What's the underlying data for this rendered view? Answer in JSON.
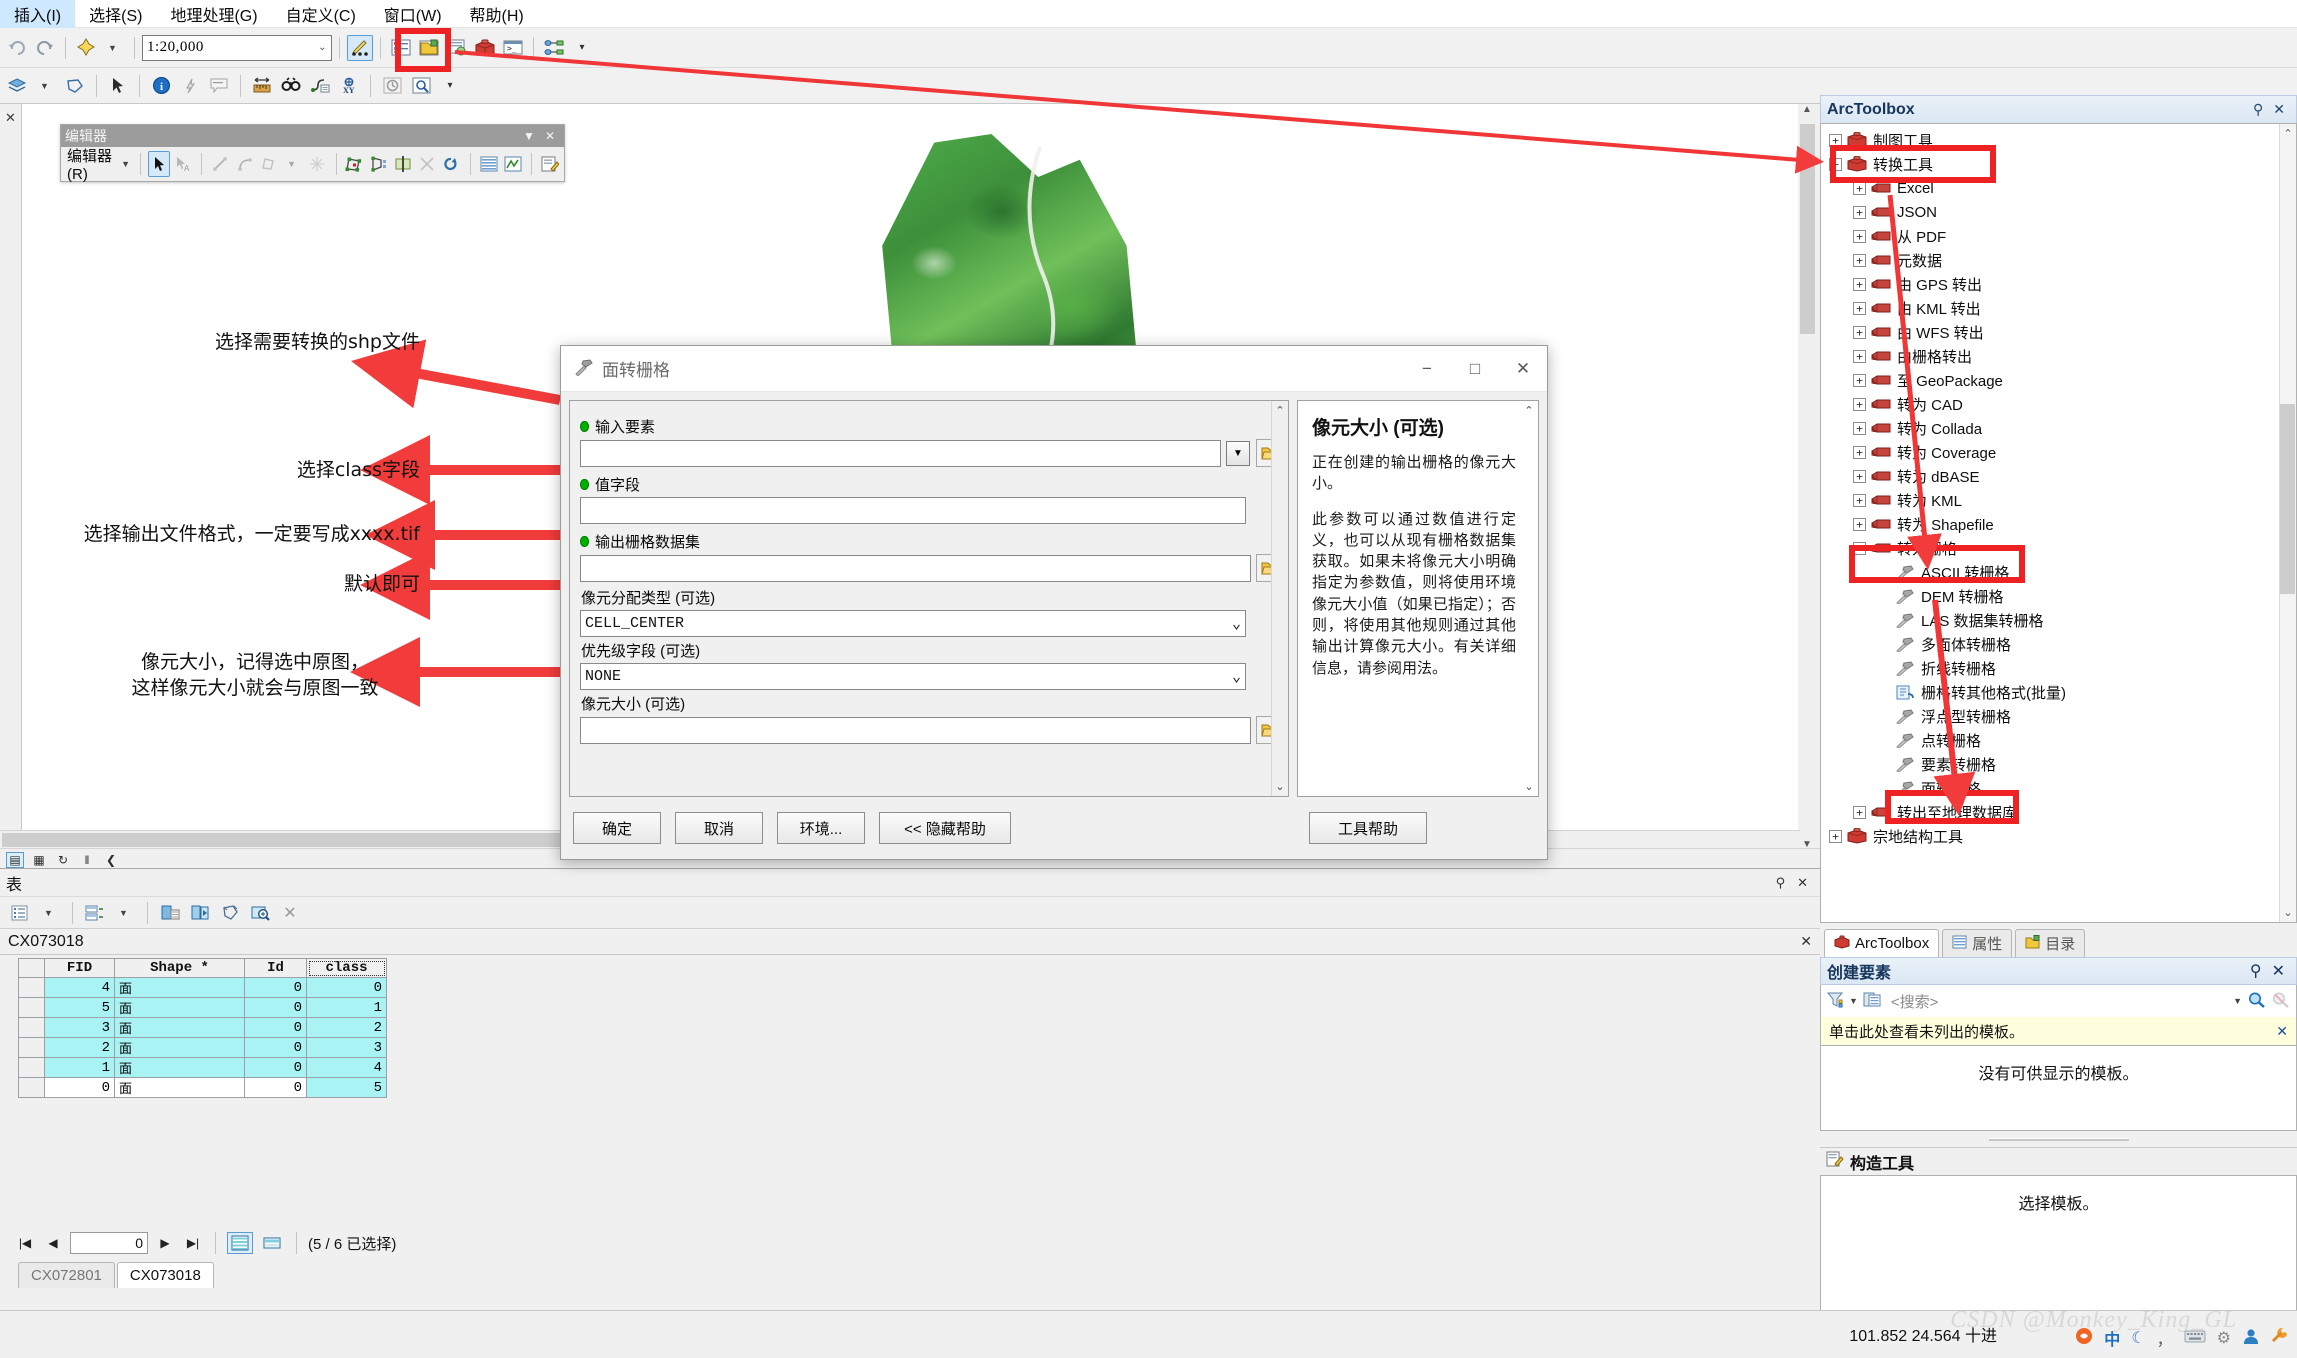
{
  "menubar": {
    "items": [
      {
        "label": "插入(I)"
      },
      {
        "label": "选择(S)"
      },
      {
        "label": "地理处理(G)"
      },
      {
        "label": "自定义(C)"
      },
      {
        "label": "窗口(W)"
      },
      {
        "label": "帮助(H)"
      }
    ]
  },
  "toolbar": {
    "scale_value": "1:20,000",
    "icons": [
      "undo-icon",
      "redo-icon",
      "pan-add-icon",
      "scale-dropdown",
      "editor-toggle-icon",
      "table-of-contents-icon",
      "catalog-icon",
      "search-window-icon",
      "arctoolbox-icon",
      "python-window-icon",
      "model-builder-icon"
    ],
    "row2_icons": [
      "layers-icon",
      "select-features-icon",
      "select-arrow-icon",
      "identify-icon",
      "hyperlink-icon",
      "html-popup-icon",
      "measure-icon",
      "find-icon",
      "find-route-icon",
      "go-to-xy-icon",
      "time-slider-icon",
      "create-viewer-window-icon"
    ]
  },
  "editor_panel": {
    "title": "编辑器",
    "menu_label": "编辑器(R)",
    "tools": [
      "edit-tool-icon",
      "edit-annotation-icon",
      "straight-segment-icon",
      "arc-segment-icon",
      "trace-icon",
      "midpoint-icon",
      "edit-vertices-icon",
      "reshape-feature-icon",
      "cut-polygons-icon",
      "split-icon",
      "rotate-icon",
      "attributes-icon",
      "sketch-properties-icon",
      "create-features-icon"
    ]
  },
  "annotations": [
    {
      "text": "选择需要转换的shp文件"
    },
    {
      "text": "选择class字段"
    },
    {
      "text": "选择输出文件格式，一定要写成xxxx.tif"
    },
    {
      "text": "默认即可"
    },
    {
      "text": "像元大小，记得选中原图，\n这样像元大小就会与原图一致"
    }
  ],
  "dialog": {
    "title": "面转栅格",
    "window_buttons": {
      "minimize": "−",
      "maximize": "□",
      "close": "✕"
    },
    "fields": [
      {
        "label": "输入要素",
        "value": "",
        "required": true,
        "has_dropdown": true,
        "has_browse": true
      },
      {
        "label": "值字段",
        "value": "",
        "required": true,
        "has_chevron": true,
        "has_browse": false
      },
      {
        "label": "输出栅格数据集",
        "value": "",
        "required": true,
        "has_browse": true
      },
      {
        "label": "像元分配类型 (可选)",
        "value": "CELL_CENTER",
        "required": false,
        "has_chevron": true
      },
      {
        "label": "优先级字段 (可选)",
        "value": "NONE",
        "required": false,
        "has_chevron": true
      },
      {
        "label": "像元大小 (可选)",
        "value": "",
        "required": false,
        "has_browse": true
      }
    ],
    "help": {
      "title": "像元大小 (可选)",
      "paragraphs": [
        "正在创建的输出栅格的像元大小。",
        "此参数可以通过数值进行定义，也可以从现有栅格数据集获取。如果未将像元大小明确指定为参数值，则将使用环境像元大小值（如果已指定）；否则，将使用其他规则通过其他输出计算像元大小。有关详细信息，请参阅用法。"
      ]
    },
    "buttons": {
      "ok": "确定",
      "cancel": "取消",
      "environments": "环境...",
      "hide_help": "<< 隐藏帮助",
      "tool_help": "工具帮助"
    }
  },
  "table_panel": {
    "title": "表",
    "layer_name": "CX073018",
    "toolbar_icons": [
      "table-options-icon",
      "related-tables-icon",
      "add-field-icon",
      "switch-selection-icon",
      "select-by-attributes-icon",
      "zoom-to-selected-icon",
      "delete-icon"
    ],
    "columns": [
      "FID",
      "Shape *",
      "Id",
      "class"
    ],
    "rows": [
      {
        "fid": "4",
        "shape": "面",
        "id": "0",
        "class": "0",
        "selected": true
      },
      {
        "fid": "5",
        "shape": "面",
        "id": "0",
        "class": "1",
        "selected": true
      },
      {
        "fid": "3",
        "shape": "面",
        "id": "0",
        "class": "2",
        "selected": true
      },
      {
        "fid": "2",
        "shape": "面",
        "id": "0",
        "class": "3",
        "selected": true
      },
      {
        "fid": "1",
        "shape": "面",
        "id": "0",
        "class": "4",
        "selected": true
      },
      {
        "fid": "0",
        "shape": "面",
        "id": "0",
        "class": "5",
        "selected": false
      }
    ],
    "nav": {
      "record": "0",
      "status": "(5 / 6 已选择)",
      "first": "|◀",
      "prev": "◀",
      "next": "▶",
      "last": "▶|"
    },
    "tabs": [
      {
        "label": "CX072801",
        "active": false
      },
      {
        "label": "CX073018",
        "active": true
      }
    ]
  },
  "arctoolbox": {
    "title": "ArcToolbox",
    "pin_icon": "pin-icon",
    "close_icon": "close-icon",
    "tree": [
      {
        "label": "制图工具",
        "indent": 0,
        "expander": "+",
        "icon": "toolbox-icon",
        "highlight": false
      },
      {
        "label": "转换工具",
        "indent": 0,
        "expander": "−",
        "icon": "toolbox-icon",
        "highlight": true
      },
      {
        "label": "Excel",
        "indent": 1,
        "expander": "+",
        "icon": "toolset-icon",
        "highlight": false
      },
      {
        "label": "JSON",
        "indent": 1,
        "expander": "+",
        "icon": "toolset-icon",
        "highlight": false
      },
      {
        "label": "从 PDF",
        "indent": 1,
        "expander": "+",
        "icon": "toolset-icon",
        "highlight": false
      },
      {
        "label": "元数据",
        "indent": 1,
        "expander": "+",
        "icon": "toolset-icon",
        "highlight": false
      },
      {
        "label": "由 GPS 转出",
        "indent": 1,
        "expander": "+",
        "icon": "toolset-icon",
        "highlight": false
      },
      {
        "label": "由 KML 转出",
        "indent": 1,
        "expander": "+",
        "icon": "toolset-icon",
        "highlight": false
      },
      {
        "label": "由 WFS 转出",
        "indent": 1,
        "expander": "+",
        "icon": "toolset-icon",
        "highlight": false
      },
      {
        "label": "由栅格转出",
        "indent": 1,
        "expander": "+",
        "icon": "toolset-icon",
        "highlight": false
      },
      {
        "label": "至 GeoPackage",
        "indent": 1,
        "expander": "+",
        "icon": "toolset-icon",
        "highlight": false
      },
      {
        "label": "转为 CAD",
        "indent": 1,
        "expander": "+",
        "icon": "toolset-icon",
        "highlight": false
      },
      {
        "label": "转为 Collada",
        "indent": 1,
        "expander": "+",
        "icon": "toolset-icon",
        "highlight": false
      },
      {
        "label": "转为 Coverage",
        "indent": 1,
        "expander": "+",
        "icon": "toolset-icon",
        "highlight": false
      },
      {
        "label": "转为 dBASE",
        "indent": 1,
        "expander": "+",
        "icon": "toolset-icon",
        "highlight": false
      },
      {
        "label": "转为 KML",
        "indent": 1,
        "expander": "+",
        "icon": "toolset-icon",
        "highlight": false
      },
      {
        "label": "转为 Shapefile",
        "indent": 1,
        "expander": "+",
        "icon": "toolset-icon",
        "highlight": false
      },
      {
        "label": "转为栅格",
        "indent": 1,
        "expander": "−",
        "icon": "toolset-icon",
        "highlight": true
      },
      {
        "label": "ASCII 转栅格",
        "indent": 2,
        "expander": "",
        "icon": "tool-icon",
        "highlight": false
      },
      {
        "label": "DEM 转栅格",
        "indent": 2,
        "expander": "",
        "icon": "tool-icon",
        "highlight": false
      },
      {
        "label": "LAS 数据集转栅格",
        "indent": 2,
        "expander": "",
        "icon": "tool-icon",
        "highlight": false
      },
      {
        "label": "多面体转栅格",
        "indent": 2,
        "expander": "",
        "icon": "tool-icon",
        "highlight": false
      },
      {
        "label": "折线转栅格",
        "indent": 2,
        "expander": "",
        "icon": "tool-icon",
        "highlight": false
      },
      {
        "label": "栅格转其他格式(批量)",
        "indent": 2,
        "expander": "",
        "icon": "script-tool-icon",
        "highlight": false
      },
      {
        "label": "浮点型转栅格",
        "indent": 2,
        "expander": "",
        "icon": "tool-icon",
        "highlight": false
      },
      {
        "label": "点转栅格",
        "indent": 2,
        "expander": "",
        "icon": "tool-icon",
        "highlight": false
      },
      {
        "label": "要素转栅格",
        "indent": 2,
        "expander": "",
        "icon": "tool-icon",
        "highlight": false
      },
      {
        "label": "面转栅格",
        "indent": 2,
        "expander": "",
        "icon": "tool-icon",
        "highlight": true
      },
      {
        "label": "转出至地理数据库",
        "indent": 1,
        "expander": "+",
        "icon": "toolset-icon",
        "highlight": false
      },
      {
        "label": "宗地结构工具",
        "indent": 0,
        "expander": "+",
        "icon": "toolbox-icon",
        "highlight": false
      }
    ],
    "tabs": [
      {
        "label": "ArcToolbox",
        "icon": "arctoolbox-icon",
        "active": true
      },
      {
        "label": "属性",
        "icon": "properties-icon",
        "active": false
      },
      {
        "label": "目录",
        "icon": "catalog-icon",
        "active": false
      }
    ]
  },
  "create_features": {
    "title": "创建要素",
    "search_placeholder": "<搜索>",
    "note": "单击此处查看未列出的模板。",
    "empty_message": "没有可供显示的模板。",
    "pin_icon": "pin-icon",
    "close_icon": "close-icon"
  },
  "construction_tools": {
    "title": "构造工具",
    "empty_message": "选择模板。"
  },
  "statusbar": {
    "coords": "101.852  24.564  十进",
    "watermark": "CSDN @Monkey_King_GL",
    "tray_icons": [
      "sogou-icon",
      "chinese-input-icon",
      "moon-icon",
      "comma-icon",
      "keyboard-icon",
      "settings-icon",
      "user-icon",
      "wrench-icon"
    ]
  },
  "colors": {
    "accent_red": "#ee2222",
    "selection_cyan": "#aaf3f5",
    "panel_blue": "#16365c",
    "required_green": "#00b000"
  }
}
